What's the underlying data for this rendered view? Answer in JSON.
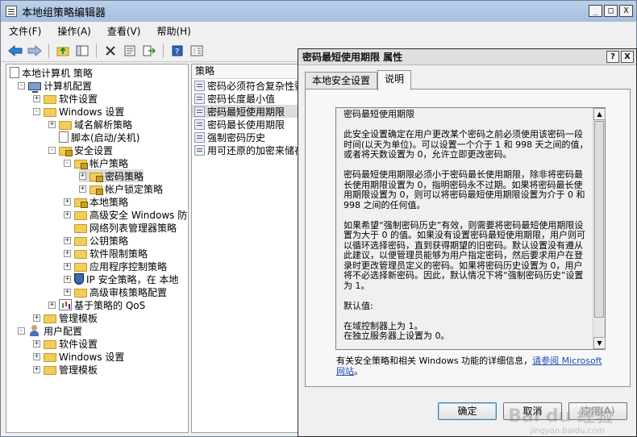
{
  "window": {
    "title": "本地组策略编辑器",
    "btn_min": "_",
    "btn_max": "□",
    "btn_close": "X"
  },
  "menu": [
    "文件(F)",
    "操作(A)",
    "查看(V)",
    "帮助(H)"
  ],
  "toolbar": {
    "icons": [
      "back-arrow-icon",
      "forward-arrow-icon",
      "up-folder-icon",
      "console-tree-icon",
      "delete-icon",
      "properties-icon",
      "export-icon",
      "help-icon",
      "extended-view-icon"
    ]
  },
  "tree": {
    "items": [
      {
        "label": "本地计算机 策略",
        "level": 0,
        "icon": "doc",
        "exp": ""
      },
      {
        "label": "计算机配置",
        "level": 1,
        "icon": "computer",
        "exp": "-"
      },
      {
        "label": "软件设置",
        "level": 2,
        "icon": "folder",
        "exp": "+"
      },
      {
        "label": "Windows 设置",
        "level": 2,
        "icon": "folder",
        "exp": "-"
      },
      {
        "label": "域名解析策略",
        "level": 3,
        "icon": "folder",
        "exp": "+"
      },
      {
        "label": "脚本(启动/关机)",
        "level": 3,
        "icon": "doc",
        "exp": ""
      },
      {
        "label": "安全设置",
        "level": 3,
        "icon": "folder-lock",
        "exp": "-"
      },
      {
        "label": "帐户策略",
        "level": 4,
        "icon": "folder-lock",
        "exp": "-"
      },
      {
        "label": "密码策略",
        "level": 5,
        "icon": "folder-lock",
        "exp": "+",
        "selected": true
      },
      {
        "label": "帐户锁定策略",
        "level": 5,
        "icon": "folder-lock",
        "exp": "+"
      },
      {
        "label": "本地策略",
        "level": 4,
        "icon": "folder-lock",
        "exp": "+"
      },
      {
        "label": "高级安全 Windows 防火",
        "level": 4,
        "icon": "folder",
        "exp": "+"
      },
      {
        "label": "网络列表管理器策略",
        "level": 4,
        "icon": "folder",
        "exp": ""
      },
      {
        "label": "公钥策略",
        "level": 4,
        "icon": "folder",
        "exp": "+"
      },
      {
        "label": "软件限制策略",
        "level": 4,
        "icon": "folder",
        "exp": "+"
      },
      {
        "label": "应用程序控制策略",
        "level": 4,
        "icon": "folder",
        "exp": "+"
      },
      {
        "label": "IP 安全策略，在 本地",
        "level": 4,
        "icon": "shield",
        "exp": "+"
      },
      {
        "label": "高级审核策略配置",
        "level": 4,
        "icon": "folder",
        "exp": "+"
      },
      {
        "label": "基于策略的 QoS",
        "level": 3,
        "icon": "chart",
        "exp": "+"
      },
      {
        "label": "管理模板",
        "level": 2,
        "icon": "folder",
        "exp": "+"
      },
      {
        "label": "用户配置",
        "level": 1,
        "icon": "user",
        "exp": "-"
      },
      {
        "label": "软件设置",
        "level": 2,
        "icon": "folder",
        "exp": "+"
      },
      {
        "label": "Windows 设置",
        "level": 2,
        "icon": "folder",
        "exp": "+"
      },
      {
        "label": "管理模板",
        "level": 2,
        "icon": "folder",
        "exp": "+"
      }
    ]
  },
  "list": {
    "header": "策略",
    "items": [
      {
        "label": "密码必须符合复杂性要求"
      },
      {
        "label": "密码长度最小值"
      },
      {
        "label": "密码最短使用期限",
        "selected": true
      },
      {
        "label": "密码最长使用期限"
      },
      {
        "label": "强制密码历史"
      },
      {
        "label": "用可还原的加密来储存密码"
      }
    ]
  },
  "dialog": {
    "title": "密码最短使用期限 属性",
    "help_btn": "?",
    "close_btn": "X",
    "tabs": [
      "本地安全设置",
      "说明"
    ],
    "active_tab": 1,
    "explain": {
      "heading": "密码最短使用期限",
      "p1": "此安全设置确定在用户更改某个密码之前必须使用该密码一段时间(以天为单位)。可以设置一个介于 1 和 998 天之间的值，或者将天数设置为 0，允许立即更改密码。",
      "p2": "密码最短使用期限必须小于密码最长使用期限，除非将密码最长使用期限设置为 0，指明密码永不过期。如果将密码最长使用期限设置为 0，则可以将密码最短使用期限设置为介于 0 和 998 之间的任何值。",
      "p3": "如果希望“强制密码历史”有效，则需要将密码最短使用期限设置为大于 0 的值。如果没有设置密码最短使用期限，用户则可以循环选择密码，直到获得期望的旧密码。默认设置没有遵从此建议，以便管理员能够为用户指定密码，然后要求用户在登录时更改管理员定义的密码。如果将密码历史设置为 0，用户将不必选择新密码。因此，默认情况下将“强制密码历史”设置为 1。",
      "default_label": "默认值:",
      "default_dc": "在域控制器上为 1。",
      "default_standalone": "在独立服务器上设置为 0。",
      "scroll_up": "▲",
      "scroll_down": "▼"
    },
    "more_info_prefix": "有关安全策略和相关 Windows 功能的详细信息，",
    "more_info_link": "请参阅 Microsoft 网站",
    "more_info_suffix": "。",
    "buttons": {
      "ok": "确定",
      "cancel": "取消",
      "apply": "应用(A)"
    }
  },
  "watermark": {
    "text": "Bai du 经验",
    "sub": "jingyan.baidu.com"
  }
}
